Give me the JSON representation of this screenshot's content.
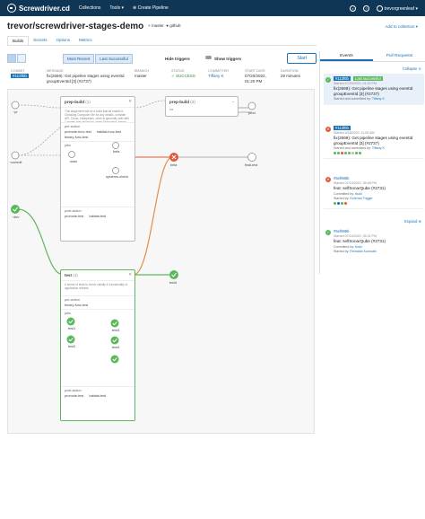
{
  "nav": {
    "brand": "Screwdriver.cd",
    "collections": "Collections",
    "tools": "Tools ▾",
    "create": "Create Pipeline",
    "user": "trevorgreenleaf ▾"
  },
  "header": {
    "repo": "trevor/screwdriver-stages-demo",
    "branch": "master",
    "scm": "github",
    "add_collection": "Add to collection"
  },
  "tabs": [
    "Builds",
    "Secrets",
    "Options",
    "Metrics"
  ],
  "toolbar": {
    "most_recent": "Most Recent",
    "last_successful": "Last Successful",
    "hide_triggers": "Hide triggers",
    "show_triggers": "Show triggers",
    "start": "Start"
  },
  "info": {
    "commit_label": "COMMIT",
    "commit": "#113f0b",
    "message_label": "MESSAGE",
    "message": "fix(2669): Get pipeline stages using eventId groupEventId [3] (#2737)",
    "branch_label": "BRANCH",
    "branch": "master",
    "status_label": "STATUS",
    "status": "SUCCESS",
    "committer_label": "COMMITTER",
    "committer": "Tiffany K",
    "start_label": "START DATE",
    "start": "07/20/2022, 01:20 PM",
    "duration_label": "DURATION",
    "duration": "29 minutes"
  },
  "graph": {
    "nodes": {
      "pr": "~pr",
      "commit": "~commit",
      "dev": "~dev",
      "prod": "prod",
      "beta": "beta",
      "final_test": "final-test",
      "build": "build",
      "main": "main",
      "beta_job": "beta",
      "systems_check": "systems-check",
      "test1": "test1",
      "test2": "test2",
      "test3": "test3",
      "test4": "test4"
    },
    "prep_build_1": {
      "title": "prep-build",
      "count": "(1)",
      "desc": "This stagement will be a build that all enable it. Checking Composer file for any details, consider API, Cloud, enterprises, other is generally with with 1 stages that will tell all. when Description-based Cloud-IT stat and to be sure.",
      "pre_action": "pre-action",
      "pre_jobs": [
        "promote-func-test",
        "habitat-func-test"
      ],
      "pre_jobs2": [
        "binary-func-test"
      ],
      "jobs": "jobs",
      "post_action": "post-action",
      "post_jobs": [
        "promote-test",
        "habitat-test"
      ]
    },
    "prep_build_2": {
      "title": "prep-build",
      "count": "(3)",
      "ellipsis": "•••"
    },
    "test_stage": {
      "title": "test",
      "count": "(4)",
      "desc": "A series of tests to check validity & functionality of application release.",
      "pre_action": "pre-action",
      "pre_jobs": [
        "binary-func-test"
      ],
      "jobs": "jobs",
      "post_action": "post-action",
      "post_jobs": [
        "promote-test",
        "habitat-test"
      ]
    }
  },
  "sidebar": {
    "tab_events": "Events",
    "tab_prs": "Pull Requests",
    "collapse": "Collapse",
    "expand": "Expand",
    "events": [
      {
        "sha": "#113f0b",
        "latest": "Last successful",
        "meta": "Started 07/20/2022, 01:20 PM",
        "message": "fix(2669): Get pipeline stages using eventId groupEventId [3] (#2737)",
        "started_by": "Started and committed by:",
        "user": "Tiffany K"
      },
      {
        "sha": "#113f0b",
        "meta": "Started 4/18/2022, 11:05 AM",
        "message": "fix(2669): Get pipeline stages using eventId groupEventId [3] (#2737)",
        "started_by": "Started and committed by:",
        "user": "Tiffany K"
      },
      {
        "sha": "#5ef989b",
        "meta": "Started 07/19/2022, 05:48 PM",
        "message": "feat: selfSonarQube (#2731)",
        "committed_by": "Committed by:",
        "committer": "tkuki",
        "started_by": "Started by:",
        "user": "External Trigger"
      },
      {
        "sha": "#5ef989b",
        "meta": "Started 07/19/2022, 05:31 PM",
        "message": "feat: selfSonarQube (#2731)",
        "committed_by": "Committed by:",
        "committer": "tkuki",
        "started_by": "Started by:",
        "user": "Reinaldo Kurosaki"
      }
    ]
  },
  "colors": {
    "nav_bg": "#0f3654",
    "accent": "#1a73b8",
    "success": "#5cb85c",
    "failure": "#e05a3a"
  }
}
